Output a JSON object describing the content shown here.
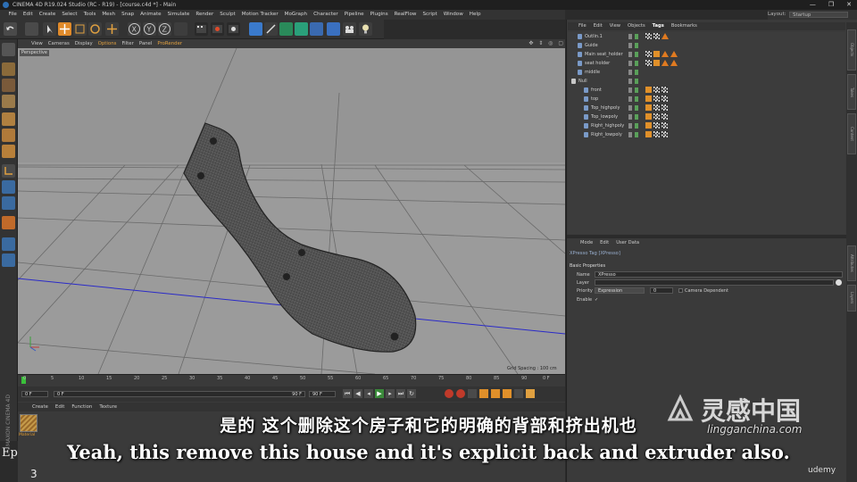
{
  "window": {
    "title": "CINEMA 4D R19.024 Studio (RC - R19) - [course.c4d *] - Main",
    "controls": [
      "—",
      "❐",
      "✕"
    ]
  },
  "menubar": {
    "items": [
      "File",
      "Edit",
      "Create",
      "Select",
      "Tools",
      "Mesh",
      "Snap",
      "Animate",
      "Simulate",
      "Render",
      "Sculpt",
      "Motion Tracker",
      "MoGraph",
      "Character",
      "Pipeline",
      "Plugins",
      "RealFlow",
      "Script",
      "Window",
      "Help"
    ]
  },
  "layout": {
    "label": "Layout:",
    "value": "Startup"
  },
  "viewport": {
    "menu": [
      "View",
      "Cameras",
      "Display",
      "Options",
      "Filter",
      "Panel",
      "ProRender"
    ],
    "label": "Perspective",
    "grid_spacing": "Grid Spacing : 100 cm"
  },
  "timeline": {
    "ticks": [
      "0",
      "5",
      "10",
      "15",
      "20",
      "25",
      "30",
      "35",
      "40",
      "45",
      "50",
      "55",
      "60",
      "65",
      "70",
      "75",
      "80",
      "85",
      "90"
    ],
    "end_frame": "0 F"
  },
  "playbar": {
    "start": "0 F",
    "min": "0 F",
    "max": "90 F",
    "end": "90 F"
  },
  "material_manager": {
    "menu": [
      "Create",
      "Edit",
      "Function",
      "Texture"
    ],
    "material_name": "Material"
  },
  "object_manager": {
    "menu": [
      "File",
      "Edit",
      "View",
      "Objects",
      "Tags",
      "Bookmarks"
    ],
    "active_menu": "Tags",
    "objects": [
      {
        "name": "Outlin.1",
        "indent": 1,
        "kind": "poly"
      },
      {
        "name": "Guide",
        "indent": 1,
        "kind": "poly"
      },
      {
        "name": "Main seat_holder",
        "indent": 1,
        "kind": "poly"
      },
      {
        "name": "seat holder",
        "indent": 1,
        "kind": "poly"
      },
      {
        "name": "middle",
        "indent": 1,
        "kind": "poly"
      },
      {
        "name": "Null",
        "indent": 0,
        "kind": "null"
      },
      {
        "name": "front",
        "indent": 2,
        "kind": "poly"
      },
      {
        "name": "top",
        "indent": 2,
        "kind": "poly"
      },
      {
        "name": "Top_highpoly",
        "indent": 2,
        "kind": "poly"
      },
      {
        "name": "Top_lowpoly",
        "indent": 2,
        "kind": "poly"
      },
      {
        "name": "Right_highpoly",
        "indent": 2,
        "kind": "poly"
      },
      {
        "name": "Right_lowpoly",
        "indent": 2,
        "kind": "poly"
      }
    ]
  },
  "attributes": {
    "menu": [
      "Mode",
      "Edit",
      "User Data"
    ],
    "title": "XPresso Tag [XPresso]",
    "section": "Basic Properties",
    "name_label": "Name",
    "name_value": "XPresso",
    "layer_label": "Layer",
    "priority_label": "Priority",
    "priority_value": "Expression",
    "priority_num": "0",
    "camera_dependent": "Camera Dependent",
    "enable_label": "Enable"
  },
  "subtitles": {
    "zh": "是的 这个删除这个房子和它的明确的背部和挤出机也",
    "en": "Yeah, this remove this house and it's explicit back and extruder also."
  },
  "watermark": {
    "brand": "灵感中国",
    "url": "lingganchina.com",
    "udemy": "udemy",
    "episode": "Ep",
    "episode_num": "3"
  },
  "colors": {
    "accent": "#e0a040",
    "viewport_bg": "#9a9a9a",
    "panel": "#3a3a3a"
  }
}
